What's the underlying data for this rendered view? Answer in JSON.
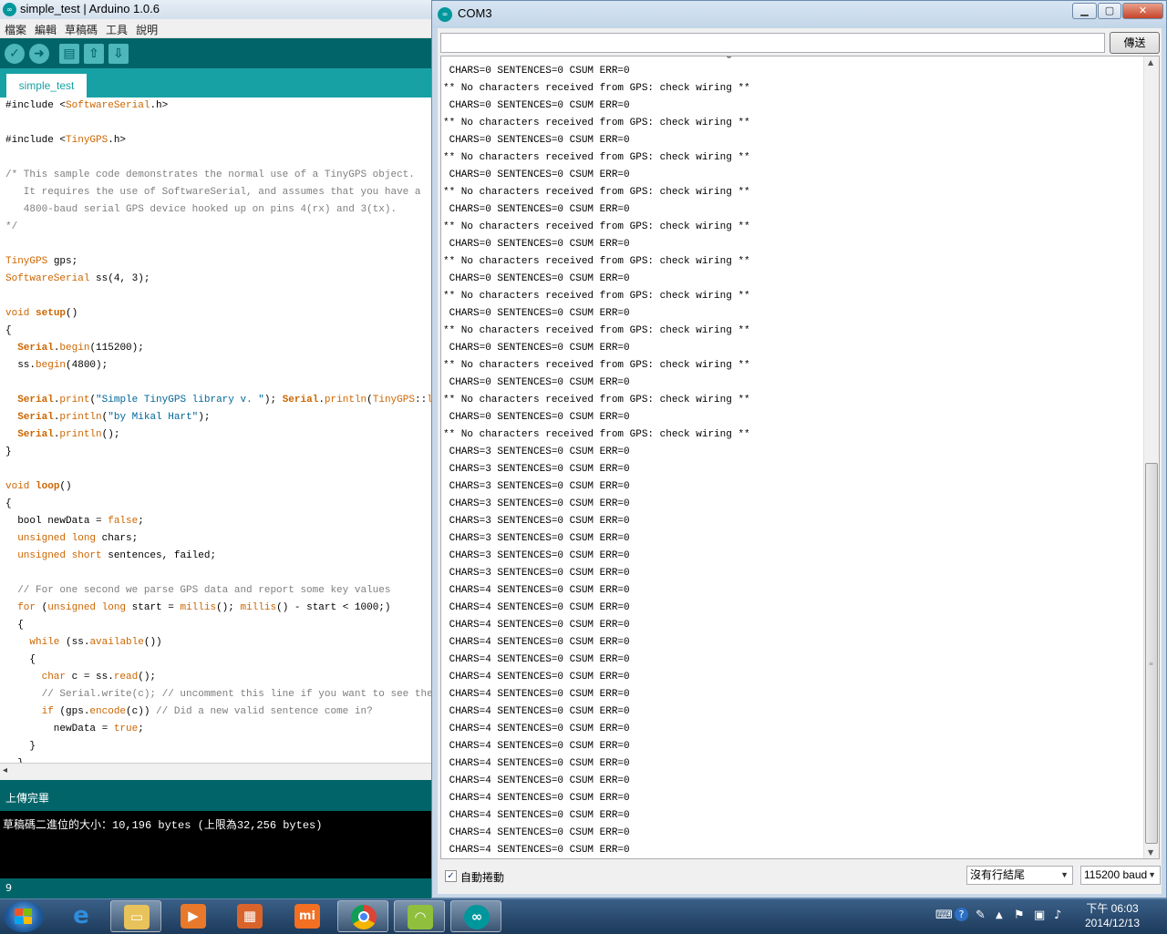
{
  "ide": {
    "title": "simple_test | Arduino 1.0.6",
    "menu": [
      "檔案",
      "編輯",
      "草稿碼",
      "工具",
      "說明"
    ],
    "tab": "simple_test",
    "status": "上傳完畢",
    "console": "草稿碼二進位的大小：10,196 bytes (上限為32,256 bytes)",
    "line_number": "9",
    "code_lines": [
      [
        [
          "",
          "#include <"
        ],
        [
          "kw",
          "SoftwareSerial"
        ],
        [
          "",
          ".h>"
        ]
      ],
      [],
      [
        [
          "",
          "#include <"
        ],
        [
          "kw",
          "TinyGPS"
        ],
        [
          "",
          ".h>"
        ]
      ],
      [],
      [
        [
          "cm",
          "/* This sample code demonstrates the normal use of a TinyGPS object."
        ]
      ],
      [
        [
          "cm",
          "   It requires the use of SoftwareSerial, and assumes that you have a"
        ]
      ],
      [
        [
          "cm",
          "   4800-baud serial GPS device hooked up on pins 4(rx) and 3(tx)."
        ]
      ],
      [
        [
          "cm",
          "*/"
        ]
      ],
      [],
      [
        [
          "kw",
          "TinyGPS"
        ],
        [
          "",
          " gps;"
        ]
      ],
      [
        [
          "kw",
          "SoftwareSerial"
        ],
        [
          "",
          " ss(4, 3);"
        ]
      ],
      [],
      [
        [
          "kw",
          "void"
        ],
        [
          "",
          " "
        ],
        [
          "fn",
          "setup"
        ],
        [
          "",
          "()"
        ]
      ],
      [
        [
          "",
          "{"
        ]
      ],
      [
        [
          "",
          "  "
        ],
        [
          "fn",
          "Serial"
        ],
        [
          "",
          "."
        ],
        [
          "kw",
          "begin"
        ],
        [
          "",
          "(115200);"
        ]
      ],
      [
        [
          "",
          "  ss."
        ],
        [
          "kw",
          "begin"
        ],
        [
          "",
          "(4800);"
        ]
      ],
      [],
      [
        [
          "",
          "  "
        ],
        [
          "fn",
          "Serial"
        ],
        [
          "",
          "."
        ],
        [
          "kw",
          "print"
        ],
        [
          "",
          "("
        ],
        [
          "st",
          "\"Simple TinyGPS library v. \""
        ],
        [
          "",
          "); "
        ],
        [
          "fn",
          "Serial"
        ],
        [
          "",
          "."
        ],
        [
          "kw",
          "println"
        ],
        [
          "",
          "("
        ],
        [
          "kw",
          "TinyGPS"
        ],
        [
          "",
          "::"
        ],
        [
          "kw",
          "library_v"
        ]
      ],
      [
        [
          "",
          "  "
        ],
        [
          "fn",
          "Serial"
        ],
        [
          "",
          "."
        ],
        [
          "kw",
          "println"
        ],
        [
          "",
          "("
        ],
        [
          "st",
          "\"by Mikal Hart\""
        ],
        [
          "",
          ");"
        ]
      ],
      [
        [
          "",
          "  "
        ],
        [
          "fn",
          "Serial"
        ],
        [
          "",
          "."
        ],
        [
          "kw",
          "println"
        ],
        [
          "",
          "();"
        ]
      ],
      [
        [
          "",
          "}"
        ]
      ],
      [],
      [
        [
          "kw",
          "void"
        ],
        [
          "",
          " "
        ],
        [
          "fn",
          "loop"
        ],
        [
          "",
          "()"
        ]
      ],
      [
        [
          "",
          "{"
        ]
      ],
      [
        [
          "",
          "  bool newData = "
        ],
        [
          "kw",
          "false"
        ],
        [
          "",
          ";"
        ]
      ],
      [
        [
          "",
          "  "
        ],
        [
          "kw",
          "unsigned long"
        ],
        [
          "",
          " chars;"
        ]
      ],
      [
        [
          "",
          "  "
        ],
        [
          "kw",
          "unsigned short"
        ],
        [
          "",
          " sentences, failed;"
        ]
      ],
      [],
      [
        [
          "cm",
          "  // For one second we parse GPS data and report some key values"
        ]
      ],
      [
        [
          "",
          "  "
        ],
        [
          "kw",
          "for"
        ],
        [
          "",
          " ("
        ],
        [
          "kw",
          "unsigned long"
        ],
        [
          "",
          " start = "
        ],
        [
          "kw",
          "millis"
        ],
        [
          "",
          "(); "
        ],
        [
          "kw",
          "millis"
        ],
        [
          "",
          "() - start < 1000;)"
        ]
      ],
      [
        [
          "",
          "  {"
        ]
      ],
      [
        [
          "",
          "    "
        ],
        [
          "kw",
          "while"
        ],
        [
          "",
          " (ss."
        ],
        [
          "kw",
          "available"
        ],
        [
          "",
          "())"
        ]
      ],
      [
        [
          "",
          "    {"
        ]
      ],
      [
        [
          "",
          "      "
        ],
        [
          "kw",
          "char"
        ],
        [
          "",
          " c = ss."
        ],
        [
          "kw",
          "read"
        ],
        [
          "",
          "();"
        ]
      ],
      [
        [
          "cm",
          "      // Serial.write(c); // uncomment this line if you want to see the GPS da"
        ]
      ],
      [
        [
          "",
          "      "
        ],
        [
          "kw",
          "if"
        ],
        [
          "",
          " (gps."
        ],
        [
          "kw",
          "encode"
        ],
        [
          "",
          "(c)) "
        ],
        [
          "cm",
          "// Did a new valid sentence come in?"
        ]
      ],
      [
        [
          "",
          "        newData = "
        ],
        [
          "kw",
          "true"
        ],
        [
          "",
          ";"
        ]
      ],
      [
        [
          "",
          "    }"
        ]
      ],
      [
        [
          "",
          "  }"
        ]
      ]
    ]
  },
  "serial": {
    "title": "COM3",
    "send_label": "傳送",
    "autoscroll_label": "自動捲動",
    "line_ending": "沒有行結尾",
    "baud": "115200 baud",
    "lines": [
      "** No characters received from GPS: check wiring **",
      " CHARS=0 SENTENCES=0 CSUM ERR=0",
      "** No characters received from GPS: check wiring **",
      " CHARS=0 SENTENCES=0 CSUM ERR=0",
      "** No characters received from GPS: check wiring **",
      " CHARS=0 SENTENCES=0 CSUM ERR=0",
      "** No characters received from GPS: check wiring **",
      " CHARS=0 SENTENCES=0 CSUM ERR=0",
      "** No characters received from GPS: check wiring **",
      " CHARS=0 SENTENCES=0 CSUM ERR=0",
      "** No characters received from GPS: check wiring **",
      " CHARS=0 SENTENCES=0 CSUM ERR=0",
      "** No characters received from GPS: check wiring **",
      " CHARS=0 SENTENCES=0 CSUM ERR=0",
      "** No characters received from GPS: check wiring **",
      " CHARS=0 SENTENCES=0 CSUM ERR=0",
      "** No characters received from GPS: check wiring **",
      " CHARS=0 SENTENCES=0 CSUM ERR=0",
      "** No characters received from GPS: check wiring **",
      " CHARS=0 SENTENCES=0 CSUM ERR=0",
      "** No characters received from GPS: check wiring **",
      " CHARS=0 SENTENCES=0 CSUM ERR=0",
      "** No characters received from GPS: check wiring **",
      " CHARS=3 SENTENCES=0 CSUM ERR=0",
      " CHARS=3 SENTENCES=0 CSUM ERR=0",
      " CHARS=3 SENTENCES=0 CSUM ERR=0",
      " CHARS=3 SENTENCES=0 CSUM ERR=0",
      " CHARS=3 SENTENCES=0 CSUM ERR=0",
      " CHARS=3 SENTENCES=0 CSUM ERR=0",
      " CHARS=3 SENTENCES=0 CSUM ERR=0",
      " CHARS=3 SENTENCES=0 CSUM ERR=0",
      " CHARS=4 SENTENCES=0 CSUM ERR=0",
      " CHARS=4 SENTENCES=0 CSUM ERR=0",
      " CHARS=4 SENTENCES=0 CSUM ERR=0",
      " CHARS=4 SENTENCES=0 CSUM ERR=0",
      " CHARS=4 SENTENCES=0 CSUM ERR=0",
      " CHARS=4 SENTENCES=0 CSUM ERR=0",
      " CHARS=4 SENTENCES=0 CSUM ERR=0",
      " CHARS=4 SENTENCES=0 CSUM ERR=0",
      " CHARS=4 SENTENCES=0 CSUM ERR=0",
      " CHARS=4 SENTENCES=0 CSUM ERR=0",
      " CHARS=4 SENTENCES=0 CSUM ERR=0",
      " CHARS=4 SENTENCES=0 CSUM ERR=0",
      " CHARS=4 SENTENCES=0 CSUM ERR=0",
      " CHARS=4 SENTENCES=0 CSUM ERR=0",
      " CHARS=4 SENTENCES=0 CSUM ERR=0",
      " CHARS=4 SENTENCES=0 CSUM ERR=0",
      " CHARS=4 SENTENCES=0 CSUM ERR=0",
      " CHARS=4 SENTENCES=0 CSUM ERR=0"
    ]
  },
  "taskbar": {
    "apps": [
      "windows-start",
      "internet-explorer",
      "file-explorer",
      "media-player",
      "control-panel",
      "mi",
      "chrome",
      "android-studio",
      "arduino"
    ],
    "clock_time": "下午 06:03",
    "clock_date": "2014/12/13"
  },
  "colors": {
    "arduino_teal": "#006468",
    "arduino_tab": "#17a1a5",
    "keyword": "#cc6600",
    "comment": "#7e7e7e",
    "string": "#006699"
  }
}
